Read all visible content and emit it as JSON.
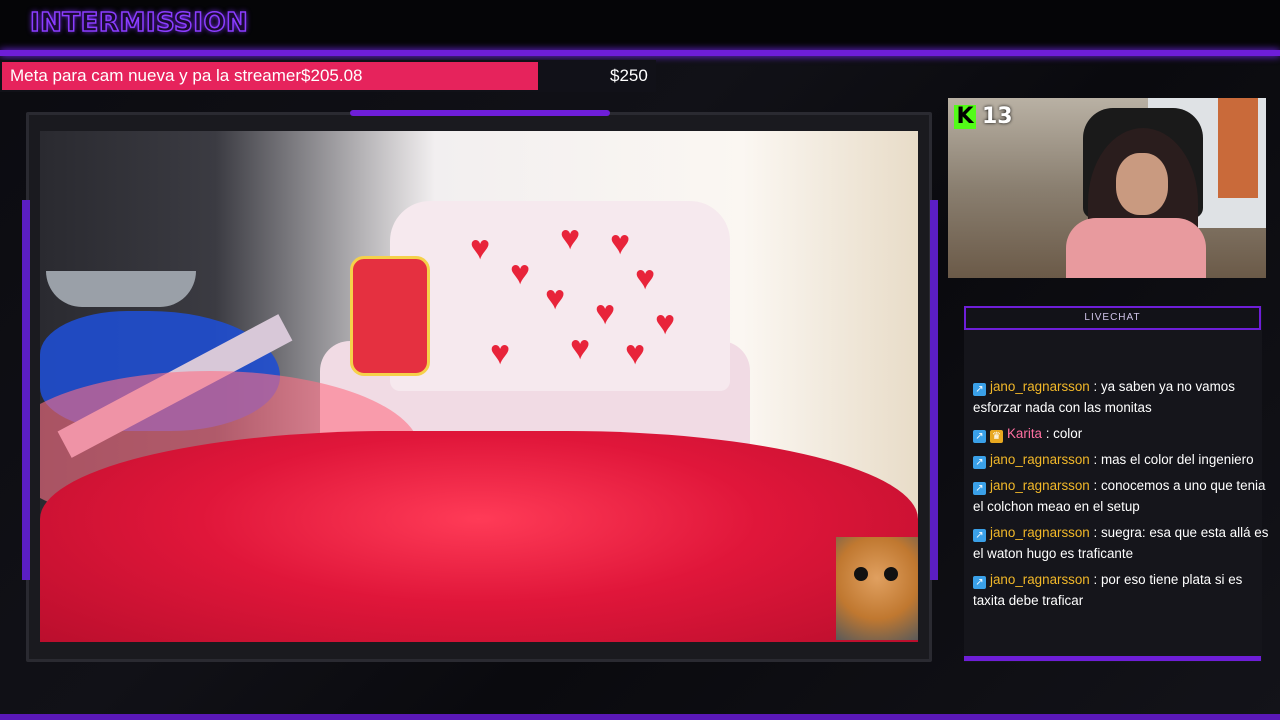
{
  "header": {
    "title": "INTERMISSION"
  },
  "goal": {
    "label": "Meta para cam nueva y pa la streamer",
    "current": "$205.08",
    "target": "$250",
    "progress_fraction": 0.8203,
    "fill_color": "#e6235c"
  },
  "webcam": {
    "platform_icon": "kick-logo-icon",
    "viewer_count": "13"
  },
  "chat": {
    "header": "LIVECHAT",
    "accent_color": "#6e1ed8",
    "messages": [
      {
        "badges": [
          "sub-badge-icon"
        ],
        "user": "jano_ragnarsson",
        "sep": ":",
        "text": "ya saben ya no vamos esforzar nada con las monitas"
      },
      {
        "badges": [
          "sub-badge-icon",
          "crown-badge-icon"
        ],
        "user": "Karita",
        "sep": ":",
        "text": "color"
      },
      {
        "badges": [
          "sub-badge-icon"
        ],
        "user": "jano_ragnarsson",
        "sep": ":",
        "text": "mas el color del ingeniero"
      },
      {
        "badges": [
          "sub-badge-icon"
        ],
        "user": "jano_ragnarsson",
        "sep": ":",
        "text": "conocemos a uno que tenia el colchon meao en el setup"
      },
      {
        "badges": [
          "sub-badge-icon"
        ],
        "user": "jano_ragnarsson",
        "sep": ":",
        "text": "suegra: esa que esta allá es el waton hugo es traficante"
      },
      {
        "badges": [
          "sub-badge-icon"
        ],
        "user": "jano_ragnarsson",
        "sep": ":",
        "text": "por eso tiene plata si es taxita debe traficar"
      }
    ]
  },
  "colors": {
    "frame_purple": "#6e1ed8",
    "username": "#f2b829",
    "username_alt": "#ff6fa0"
  }
}
